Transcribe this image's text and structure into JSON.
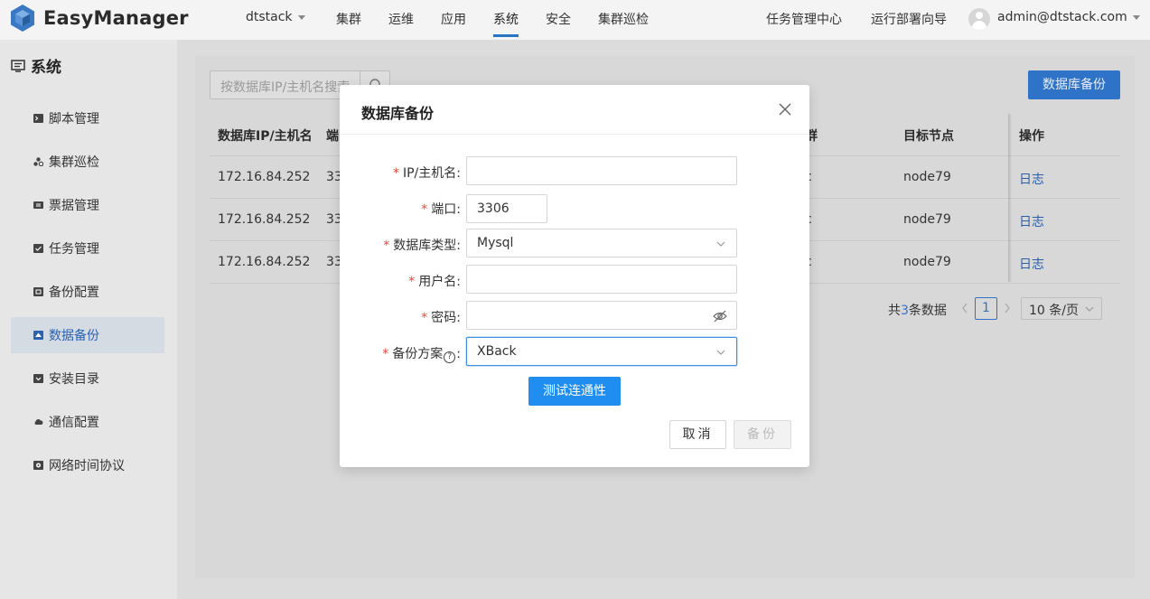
{
  "header": {
    "logo_text": "EasyManager",
    "cluster_selector": "dtstack",
    "nav": [
      "集群",
      "运维",
      "应用",
      "系统",
      "安全",
      "集群巡检"
    ],
    "active_nav": "系统",
    "task_center": "任务管理中心",
    "deploy_guide": "运行部署向导",
    "user": "admin@dtstack.com"
  },
  "sidebar": {
    "title": "系统",
    "items": [
      {
        "label": "脚本管理",
        "icon": "terminal-icon"
      },
      {
        "label": "集群巡检",
        "icon": "cluster-icon"
      },
      {
        "label": "票据管理",
        "icon": "ticket-icon"
      },
      {
        "label": "任务管理",
        "icon": "task-icon"
      },
      {
        "label": "备份配置",
        "icon": "backup-config-icon"
      },
      {
        "label": "数据备份",
        "icon": "database-backup-icon",
        "active": true
      },
      {
        "label": "安装目录",
        "icon": "install-dir-icon"
      },
      {
        "label": "通信配置",
        "icon": "cloud-icon"
      },
      {
        "label": "网络时间协议",
        "icon": "ntp-icon"
      }
    ]
  },
  "main": {
    "search_placeholder": "按数据库IP/主机名搜索",
    "backup_button": "数据库备份",
    "columns": {
      "host": "数据库IP/主机名",
      "port": "端口",
      "cluster": "群",
      "target": "目标节点",
      "action": "操作"
    },
    "rows": [
      {
        "host": "172.16.84.252",
        "port": "33",
        "cluster": "c",
        "target": "node79",
        "action": "日志"
      },
      {
        "host": "172.16.84.252",
        "port": "33",
        "cluster": "c",
        "target": "node79",
        "action": "日志"
      },
      {
        "host": "172.16.84.252",
        "port": "33",
        "cluster": "c",
        "target": "node79",
        "action": "日志"
      }
    ],
    "pager": {
      "total_prefix": "共",
      "total": "3",
      "total_suffix": "条数据",
      "page": "1",
      "page_size": "10 条/页"
    }
  },
  "modal": {
    "title": "数据库备份",
    "fields": {
      "host": {
        "label": "IP/主机名:",
        "value": ""
      },
      "port": {
        "label": "端口:",
        "value": "3306"
      },
      "db_type": {
        "label": "数据库类型:",
        "value": "Mysql"
      },
      "username": {
        "label": "用户名:",
        "value": ""
      },
      "password": {
        "label": "密码:",
        "value": ""
      },
      "scheme": {
        "label_prefix": "备份方案",
        "label_suffix": ":",
        "value": "XBack"
      }
    },
    "required_mark": "*",
    "test_button": "测试连通性",
    "cancel_button": "取消",
    "submit_button": "备份"
  },
  "colors": {
    "accent": "#1f8ef0",
    "required": "#e5463a",
    "primary_dark": "#2f73c9"
  }
}
